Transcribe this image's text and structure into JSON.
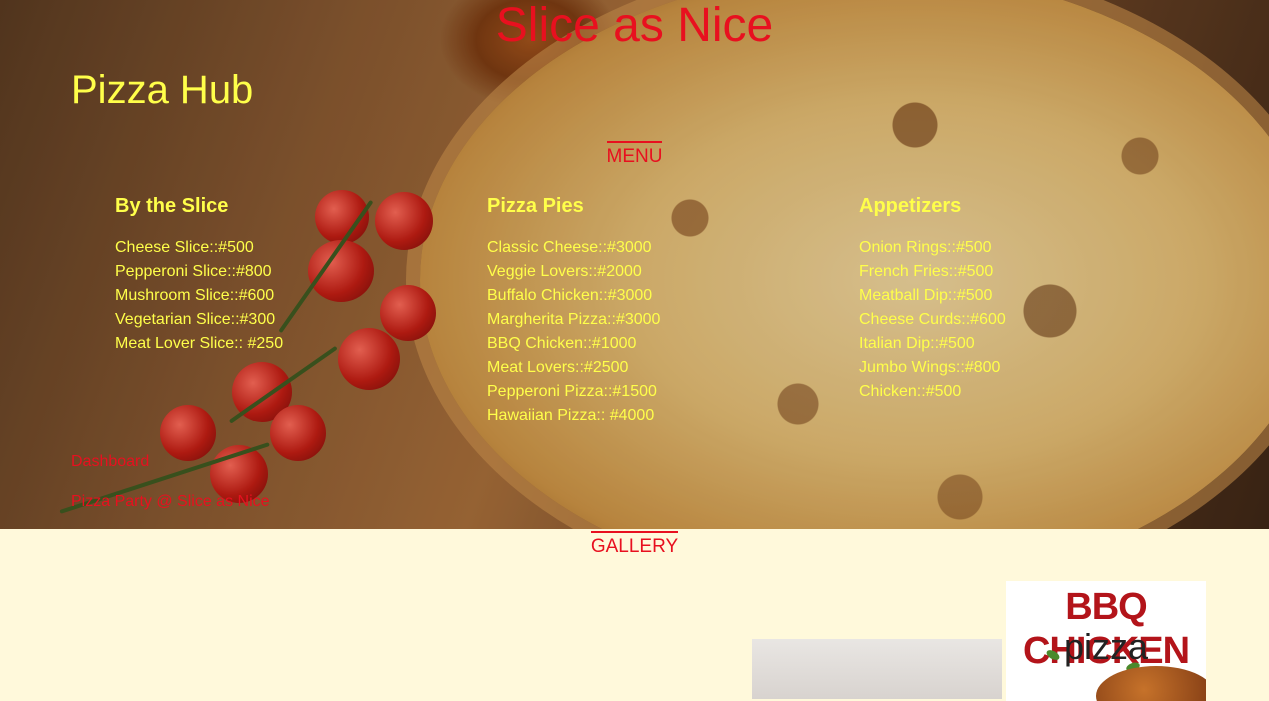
{
  "site": {
    "title": "Slice as Nice",
    "brand": "Pizza Hub"
  },
  "menu": {
    "title": "MENU",
    "columns": [
      {
        "heading": "By the Slice",
        "items": [
          "Cheese Slice::#500",
          "Pepperoni Slice::#800",
          "Mushroom Slice::#600",
          "Vegetarian Slice::#300",
          "Meat Lover Slice:: #250"
        ]
      },
      {
        "heading": "Pizza Pies",
        "items": [
          "Classic Cheese::#3000",
          "Veggie Lovers::#2000",
          "Buffalo Chicken::#3000",
          "Margherita Pizza::#3000",
          "BBQ Chicken::#1000",
          "Meat Lovers::#2500",
          "Pepperoni Pizza::#1500",
          "Hawaiian Pizza:: #4000"
        ]
      },
      {
        "heading": "Appetizers",
        "items": [
          "Onion Rings::#500",
          "French Fries::#500",
          "Meatball Dip::#500",
          "Cheese Curds::#600",
          "Italian Dip::#500",
          "Jumbo Wings::#800",
          "Chicken::#500"
        ]
      }
    ]
  },
  "links": {
    "dashboard": "Dashboard",
    "party": "Pizza Party @ Slice as Nice"
  },
  "gallery": {
    "title": "GALLERY",
    "poster_line1": "BBQ CHICKEN",
    "poster_line2": "pizza"
  },
  "colors": {
    "title_red": "#e8101f",
    "menu_yellow": "#ffff4a",
    "page_bg": "#fff9db"
  }
}
